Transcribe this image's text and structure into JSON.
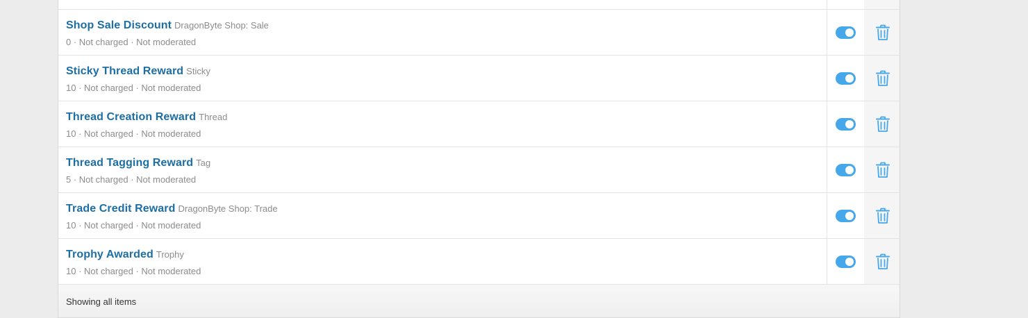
{
  "colors": {
    "link": "#1c6ea4",
    "muted": "#8c8c8c",
    "toggle_on": "#47a7eb",
    "delete_icon": "#47a7eb"
  },
  "items": [
    {
      "title": "Shop Sale Discount",
      "type": "DragonByte Shop: Sale",
      "meta": "0 · Not charged · Not moderated",
      "enabled": true
    },
    {
      "title": "Sticky Thread Reward",
      "type": "Sticky",
      "meta": "10 · Not charged · Not moderated",
      "enabled": true
    },
    {
      "title": "Thread Creation Reward",
      "type": "Thread",
      "meta": "10 · Not charged · Not moderated",
      "enabled": true
    },
    {
      "title": "Thread Tagging Reward",
      "type": "Tag",
      "meta": "5 · Not charged · Not moderated",
      "enabled": true
    },
    {
      "title": "Trade Credit Reward",
      "type": "DragonByte Shop: Trade",
      "meta": "10 · Not charged · Not moderated",
      "enabled": true
    },
    {
      "title": "Trophy Awarded",
      "type": "Trophy",
      "meta": "10 · Not charged · Not moderated",
      "enabled": true
    }
  ],
  "icons": {
    "toggle": "toggle-switch-icon",
    "delete": "trash-icon"
  },
  "footer": {
    "text": "Showing all items"
  }
}
